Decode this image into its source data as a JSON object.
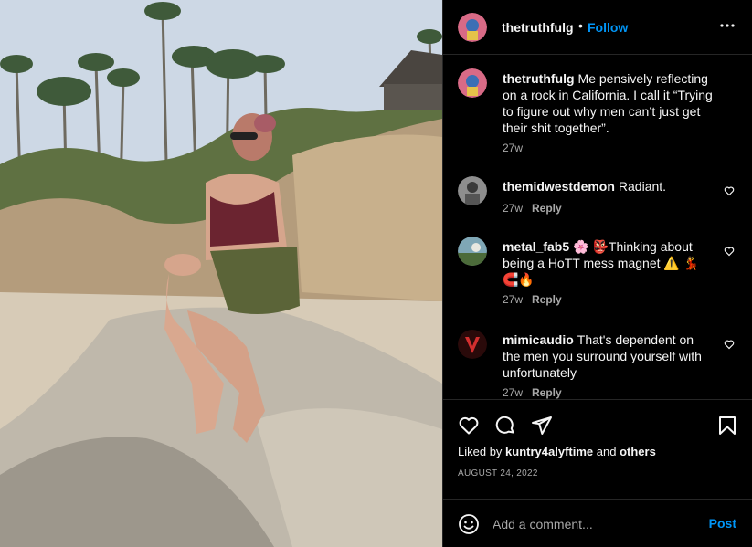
{
  "photo": {
    "alt_subject": "woman-sitting-on-rock-at-beach"
  },
  "post": {
    "author": "thetruthfulg",
    "separator": "•",
    "follow_label": "Follow",
    "more_icon": "more-horizontal-icon",
    "caption": "Me pensively reflecting on a rock in California. I call it “Trying to figure out why men can’t just get their shit together”.",
    "caption_time": "27w"
  },
  "comments": [
    {
      "username": "themidwestdemon",
      "text": "Radiant.",
      "time": "27w",
      "reply": "Reply"
    },
    {
      "username": "metal_fab5",
      "text": "🌸 👺Thinking about being a HoTT mess magnet ⚠️ 💃 🧲🔥",
      "time": "27w",
      "reply": "Reply"
    },
    {
      "username": "mimicaudio",
      "text": "That's dependent on the men you surround yourself with unfortunately",
      "time": "27w",
      "reply": "Reply"
    }
  ],
  "actions": {
    "liked_prefix": "Liked by",
    "liked_user": "kuntry4alyftime",
    "liked_and": "and",
    "liked_others": "others",
    "date": "AUGUST 24, 2022"
  },
  "add_comment": {
    "placeholder": "Add a comment...",
    "post_label": "Post"
  },
  "colors": {
    "background": "#000000",
    "text": "#f5f5f5",
    "secondary": "#a8a8a8",
    "link": "#0095f6",
    "divider": "#262626"
  }
}
